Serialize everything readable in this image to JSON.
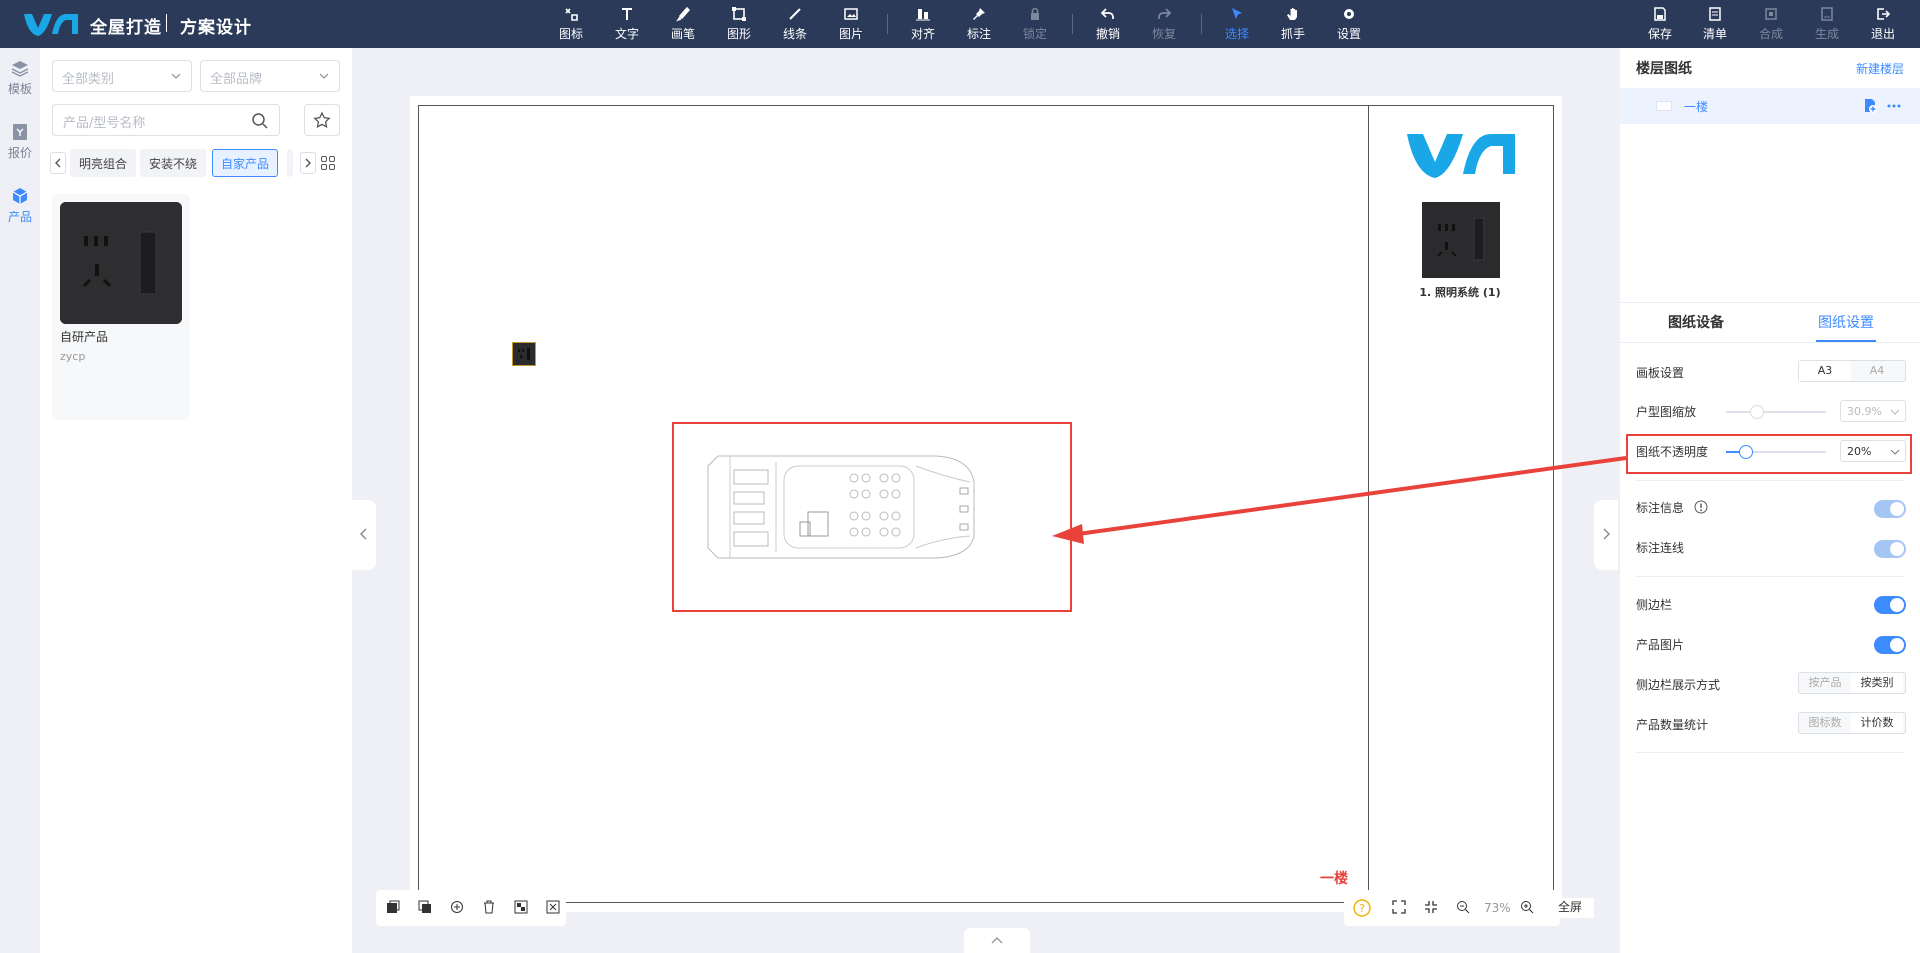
{
  "app": {
    "brand": "全屋打造",
    "section": "方案设计"
  },
  "toolbar": {
    "items": [
      {
        "label": "图标",
        "icon": "icon-tool-icon"
      },
      {
        "label": "文字",
        "icon": "text-tool-icon"
      },
      {
        "label": "画笔",
        "icon": "brush-icon"
      },
      {
        "label": "图形",
        "icon": "shape-icon"
      },
      {
        "label": "线条",
        "icon": "line-icon"
      },
      {
        "label": "图片",
        "icon": "image-icon"
      },
      {
        "label": "对齐",
        "icon": "align-icon"
      },
      {
        "label": "标注",
        "icon": "pin-icon"
      },
      {
        "label": "锁定",
        "icon": "lock-icon"
      },
      {
        "label": "撤销",
        "icon": "undo-icon"
      },
      {
        "label": "恢复",
        "icon": "redo-icon"
      },
      {
        "label": "选择",
        "icon": "cursor-icon"
      },
      {
        "label": "抓手",
        "icon": "hand-icon"
      },
      {
        "label": "设置",
        "icon": "gear-icon"
      }
    ],
    "right": [
      {
        "label": "保存",
        "icon": "save-icon"
      },
      {
        "label": "清单",
        "icon": "list-icon"
      },
      {
        "label": "合成",
        "icon": "compose-icon"
      },
      {
        "label": "生成",
        "icon": "generate-icon"
      },
      {
        "label": "退出",
        "icon": "exit-icon"
      }
    ]
  },
  "leftnav": [
    {
      "label": "模板",
      "icon": "layers-icon"
    },
    {
      "label": "报价",
      "icon": "quote-icon"
    },
    {
      "label": "产品",
      "icon": "cube-icon"
    }
  ],
  "panel": {
    "category_placeholder": "全部类别",
    "brand_placeholder": "全部品牌",
    "search_placeholder": "产品/型号名称",
    "chips": [
      "明亮组合",
      "安装不绕",
      "自家产品"
    ],
    "product": {
      "name": "自研产品",
      "code": "zycp"
    }
  },
  "canvas": {
    "legend_label": "1. 照明系统 (1)",
    "floor_tag": "一楼"
  },
  "bottom": {
    "zoom": "73%",
    "fullscreen": "全屏"
  },
  "rpanel": {
    "title": "楼层图纸",
    "new_floor": "新建楼层",
    "floor_name": "一楼",
    "tab_devices": "图纸设备",
    "tab_settings": "图纸设置",
    "board_label": "画板设置",
    "board_opts": [
      "A3",
      "A4"
    ],
    "scale_label": "户型图缩放",
    "scale_value": "30.9%",
    "opacity_label": "图纸不透明度",
    "opacity_value": "20%",
    "opacity_level": 0.2,
    "mark_info": "标注信息",
    "mark_line": "标注连线",
    "sidebar": "侧边栏",
    "product_img": "产品图片",
    "sidebar_mode": "侧边栏展示方式",
    "sidebar_mode_opts": [
      "按产品",
      "按类别"
    ],
    "count_label": "产品数量统计",
    "count_opts": [
      "图标数",
      "计价数"
    ]
  },
  "colors": {
    "accent": "#3d8bff",
    "topbar": "#2c3a59",
    "annotation": "#e8423b",
    "logo": "#1aa7e8"
  }
}
